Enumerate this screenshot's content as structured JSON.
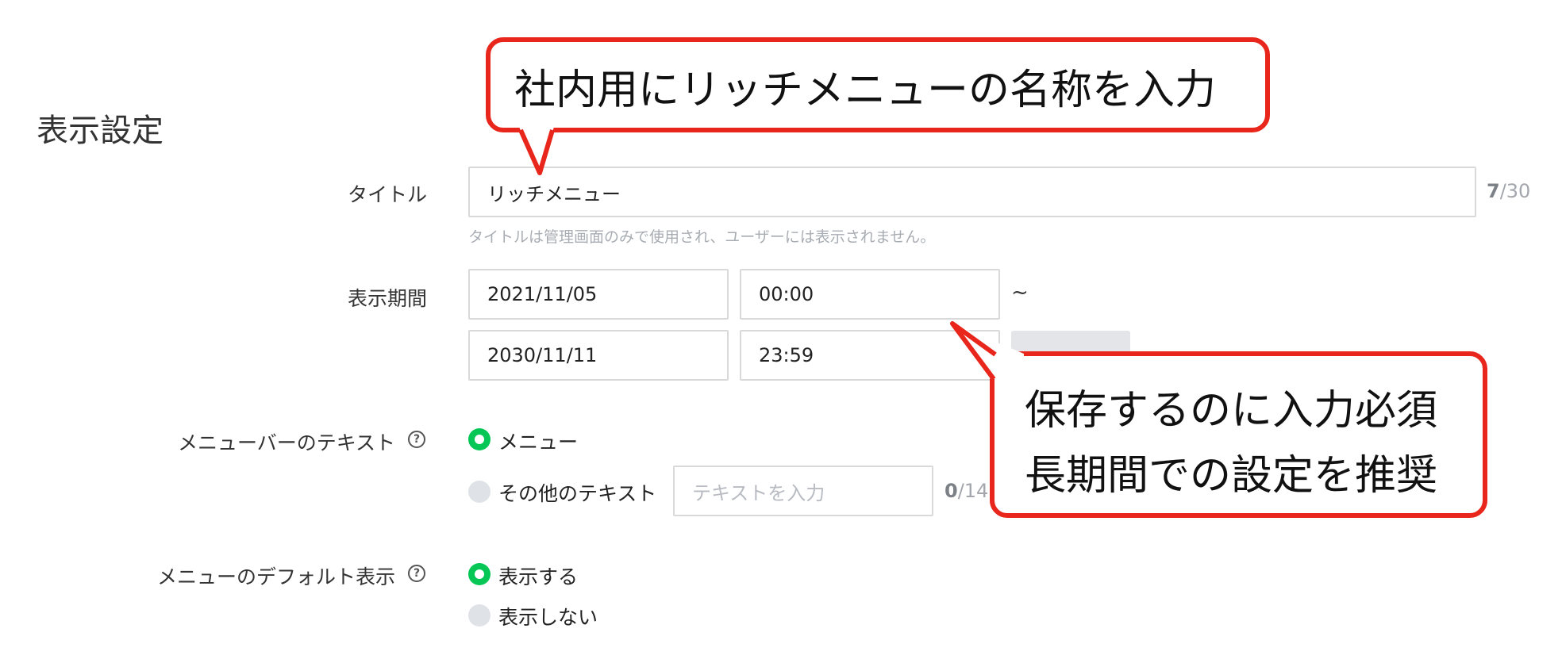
{
  "section": {
    "title": "表示設定"
  },
  "title_row": {
    "label": "タイトル",
    "value": "リッチメニュー",
    "counter_current": "7",
    "counter_max": "/30",
    "hint": "タイトルは管理画面のみで使用され、ユーザーには表示されません。"
  },
  "period_row": {
    "label": "表示期間",
    "start_date": "2021/11/05",
    "start_time": "00:00",
    "separator": "~",
    "end_date": "2030/11/11",
    "end_time": "23:59"
  },
  "menubar_row": {
    "label": "メニューバーのテキスト",
    "option_menu": "メニュー",
    "option_other": "その他のテキスト",
    "other_placeholder": "テキストを入力",
    "counter_current": "0",
    "counter_max": "/14",
    "selected": "option_menu"
  },
  "default_row": {
    "label": "メニューのデフォルト表示",
    "option_show": "表示する",
    "option_hide": "表示しない",
    "selected": "option_show"
  },
  "callouts": {
    "top": "社内用にリッチメニューの名称を入力",
    "bottom_line1": "保存するのに入力必須",
    "bottom_line2": "長期間での設定を推奨"
  },
  "icons": {
    "help": "?"
  },
  "colors": {
    "accent_green": "#06c755",
    "callout_red": "#e8261b"
  }
}
